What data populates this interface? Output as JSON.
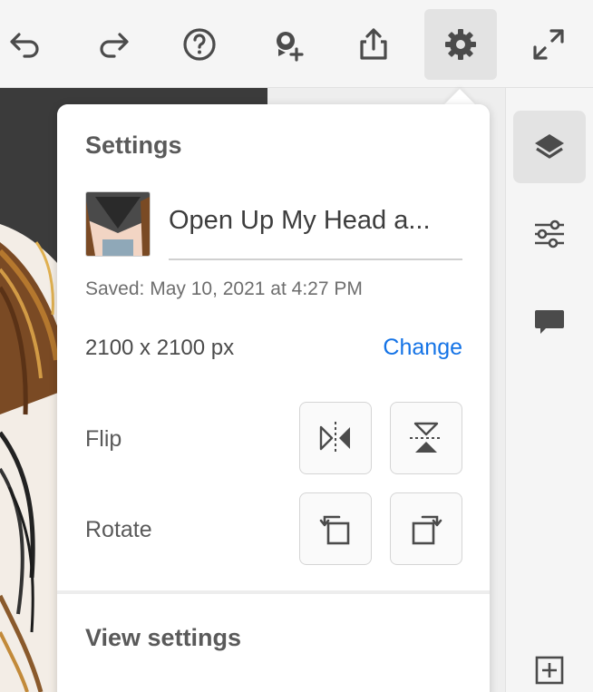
{
  "toolbar": {
    "buttons": [
      {
        "icon": "undo-icon"
      },
      {
        "icon": "redo-icon"
      },
      {
        "icon": "help-icon"
      },
      {
        "icon": "invite-icon"
      },
      {
        "icon": "share-icon"
      },
      {
        "icon": "gear-icon",
        "active": true
      },
      {
        "icon": "fullscreen-icon"
      }
    ]
  },
  "rail": {
    "items": [
      {
        "icon": "layers-icon",
        "active": true
      },
      {
        "icon": "adjustments-icon"
      },
      {
        "icon": "comment-icon"
      },
      {
        "icon": "add-layer-icon"
      }
    ]
  },
  "settings": {
    "title": "Settings",
    "document_name": "Open Up My Head a...",
    "saved": "Saved: May 10, 2021 at 4:27 PM",
    "dimensions": "2100 x 2100 px",
    "change_label": "Change",
    "flip_label": "Flip",
    "rotate_label": "Rotate",
    "view_settings_title": "View settings"
  },
  "colors": {
    "accent": "#1473e6",
    "panel_bg": "#ffffff",
    "chrome_bg": "#f5f5f5",
    "active_bg": "#e3e3e3"
  }
}
